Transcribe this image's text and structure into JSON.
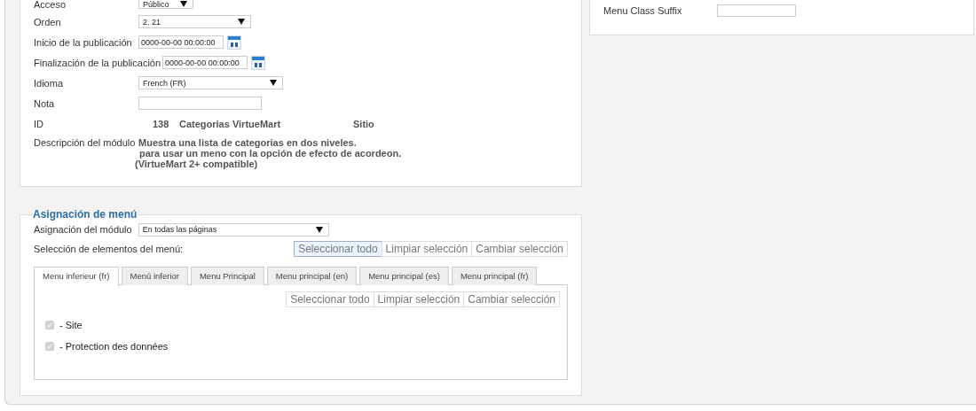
{
  "details": {
    "fields": [
      {
        "kind": "select",
        "label": "Acceso",
        "value": "Público"
      },
      {
        "kind": "select",
        "label": "Orden",
        "value": "2. 21"
      },
      {
        "kind": "date",
        "label": "Inicio de la publicación",
        "value": "0000-00-00 00:00:00"
      },
      {
        "kind": "date",
        "label": "Finalización de la publicación",
        "value": "0000-00-00 00:00:00"
      },
      {
        "kind": "select",
        "label": "Idioma",
        "value": "French (FR)"
      },
      {
        "kind": "text",
        "label": "Nota"
      },
      {
        "kind": "info",
        "label": "ID",
        "values": [
          "138",
          "Categorias VirtueMart",
          "Sitio"
        ]
      },
      {
        "kind": "description",
        "label": "Descripción del módulo",
        "lines": [
          "Muestra una lista de categorias en dos niveles.",
          "para usar un meno con la opción de efecto de acordeon.",
          "(VirtueMart 2+ compatible)"
        ]
      }
    ]
  },
  "options": {
    "fields": [
      {
        "kind": "text",
        "label": "Menu Class Suffix"
      }
    ]
  },
  "menu_assignment": {
    "legend": "Asignación de menú",
    "module_assignment": {
      "label": "Asignación del módulo",
      "value": "En todas las páginas"
    },
    "selection_label": "Selección de elementos del menú:",
    "buttons": [
      {
        "label": "Seleccionar todo",
        "selected": true
      },
      {
        "label": "Limpiar selección",
        "selected": false
      },
      {
        "label": "Cambiar selección",
        "selected": false
      }
    ],
    "tabs": [
      {
        "label": "Menu inferieur (fr)",
        "selected": true
      },
      {
        "label": "Menú inferior",
        "selected": false
      },
      {
        "label": "Menu Principal",
        "selected": false
      },
      {
        "label": "Menu principal (en)",
        "selected": false
      },
      {
        "label": "Menu principal (es)",
        "selected": false
      },
      {
        "label": "Menu principal (fr)",
        "selected": false
      }
    ],
    "panel_buttons": [
      {
        "label": "Seleccionar todo",
        "selected": false
      },
      {
        "label": "Limpiar selección",
        "selected": false
      },
      {
        "label": "Cambiar selección",
        "selected": false
      }
    ],
    "items": [
      {
        "label": "- Site",
        "checked": true,
        "disabled": true
      },
      {
        "label": "- Protection des données",
        "checked": true,
        "disabled": true
      }
    ]
  }
}
